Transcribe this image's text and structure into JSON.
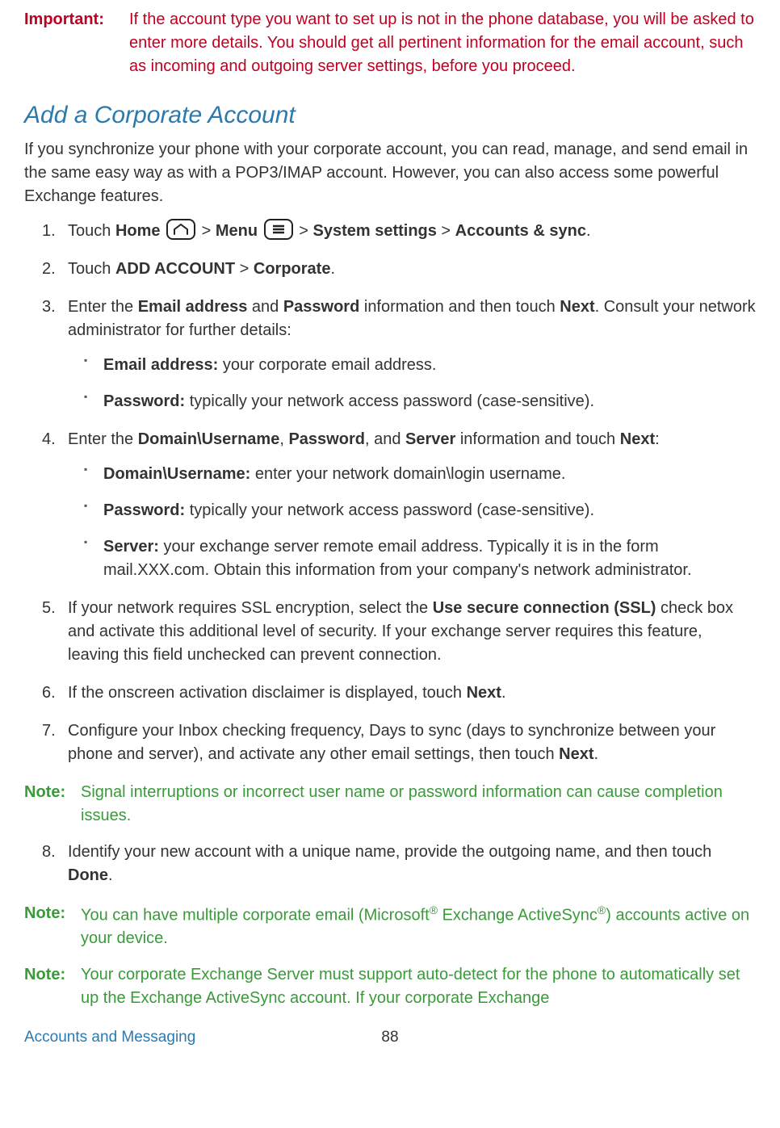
{
  "important": {
    "label": "Important:",
    "text": "If the account type you want to set up is not in the phone database, you will be asked to enter more details. You should get all pertinent information for the email account, such as incoming and outgoing server settings, before you proceed."
  },
  "heading": "Add a Corporate Account",
  "intro": "If you synchronize your phone with your corporate account, you can read, manage, and send email in the same easy way as with a POP3/IMAP account. However, you can also access some powerful Exchange features.",
  "step1": {
    "touch": "Touch ",
    "home": "Home",
    "gt1": " > ",
    "menu": "Menu",
    "gt2": " > ",
    "sys": "System settings",
    "gt3": " > ",
    "acct": "Accounts & sync",
    "end": "."
  },
  "step2": {
    "touch": "Touch ",
    "add": "ADD ACCOUNT",
    "gt": " > ",
    "corp": "Corporate",
    "end": "."
  },
  "step3": {
    "lead_a": "Enter the ",
    "email": "Email address",
    "and": " and ",
    "pwd": "Password",
    "lead_b": " information and then touch ",
    "next": "Next",
    "lead_c": ". Consult your network administrator for further details:",
    "sub_email_lbl": "Email address:",
    "sub_email_txt": " your corporate email address.",
    "sub_pwd_lbl": "Password:",
    "sub_pwd_txt": " typically your network access password (case-sensitive)."
  },
  "step4": {
    "lead_a": "Enter the ",
    "domuser": "Domain\\Username",
    "c1": ", ",
    "pwd": "Password",
    "c2": ", and ",
    "server": "Server",
    "lead_b": " information and touch ",
    "next": "Next",
    "end": ":",
    "sub_du_lbl": "Domain\\Username:",
    "sub_du_txt": " enter your network domain\\login username.",
    "sub_pwd_lbl": "Password:",
    "sub_pwd_txt": " typically your network access password (case-sensitive).",
    "sub_srv_lbl": "Server:",
    "sub_srv_txt": " your exchange server remote email address. Typically it is in the form mail.XXX.com. Obtain this information from your company's network administrator."
  },
  "step5": {
    "a": "If your network requires SSL encryption, select the ",
    "ssl": "Use secure connection (SSL)",
    "b": " check box and activate this additional level of security. If your exchange server requires this feature, leaving this field unchecked can prevent connection."
  },
  "step6": {
    "a": "If the onscreen activation disclaimer is displayed, touch ",
    "next": "Next",
    "b": "."
  },
  "step7": {
    "a": "Configure your Inbox checking frequency, Days to sync (days to synchronize between your phone and server), and activate any other email settings, then touch ",
    "next": "Next",
    "b": "."
  },
  "note1": {
    "label": "Note:",
    "text": "Signal interruptions or incorrect user name or password information can cause completion issues."
  },
  "step8": {
    "a": "Identify your new account with a unique name, provide the outgoing name, and then touch ",
    "done": "Done",
    "b": "."
  },
  "note2": {
    "label": "Note:",
    "a": "You can have multiple corporate email (Microsoft",
    "r1": "®",
    "b": " Exchange ActiveSync",
    "r2": "®",
    "c": ") accounts active on your device."
  },
  "note3": {
    "label": "Note:",
    "text": "Your corporate Exchange Server must support auto-detect for the phone to automatically set up the Exchange ActiveSync account. If your corporate Exchange"
  },
  "footer": {
    "left": "Accounts and Messaging",
    "page": "88"
  }
}
